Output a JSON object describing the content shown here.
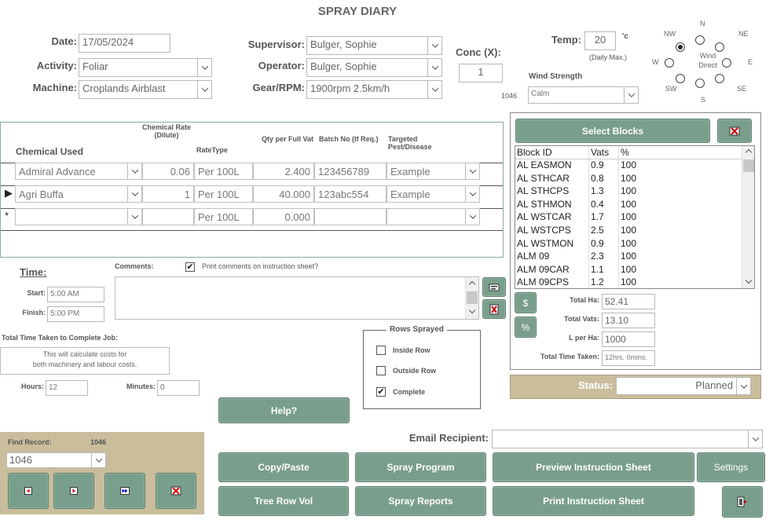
{
  "title": "SPRAY DIARY",
  "form": {
    "date_label": "Date:",
    "date_value": "17/05/2024",
    "activity_label": "Activity:",
    "activity_value": "Foliar",
    "machine_label": "Machine:",
    "machine_value": "Croplands Airblast",
    "supervisor_label": "Supervisor:",
    "supervisor_value": "Bulger, Sophie",
    "operator_label": "Operator:",
    "operator_value": "Bulger, Sophie",
    "gear_label": "Gear/RPM:",
    "gear_value": "1900rpm 2.5km/h",
    "conc_label": "Conc (X):",
    "conc_value": "1",
    "temp_label": "Temp:",
    "temp_value": "20",
    "temp_unit": "'c",
    "temp_note": "(Daily Max.)",
    "record_id_small": "1046",
    "wind_strength_label": "Wind Strength",
    "wind_strength_value": "Calm",
    "wind_direction_label": "Wind Direct",
    "wind_dirs": [
      "N",
      "NE",
      "E",
      "SE",
      "S",
      "SW",
      "W",
      "NW"
    ],
    "wind_selected": "center"
  },
  "chemicals": {
    "headers": {
      "chemical": "Chemical Used",
      "rate": "Chemical Rate (Dilute)",
      "ratetype": "RateType",
      "qty": "Qty per Full Vat",
      "batch": "Batch No (If Req.)",
      "target": "Targeted Pest/Disease"
    },
    "rows": [
      {
        "name": "Admiral Advance",
        "rate": "0.06",
        "ratetype": "Per 100L",
        "qty": "2.400",
        "batch": "123456789",
        "target": "Example",
        "marker": ""
      },
      {
        "name": "Agri Buffa",
        "rate": "1",
        "ratetype": "Per 100L",
        "qty": "40.000",
        "batch": "123abc554",
        "target": "Example",
        "marker": "▶"
      },
      {
        "name": "",
        "rate": "",
        "ratetype": "Per 100L",
        "qty": "0.000",
        "batch": "",
        "target": "",
        "marker": "*"
      }
    ]
  },
  "blocks": {
    "select_label": "Select Blocks",
    "headers": {
      "id": "Block ID",
      "vats": "Vats",
      "pct": "%"
    },
    "rows": [
      {
        "id": "AL EASMON",
        "vats": "0.9",
        "pct": "100"
      },
      {
        "id": "AL STHCAR",
        "vats": "0.8",
        "pct": "100"
      },
      {
        "id": "AL STHCPS",
        "vats": "1.3",
        "pct": "100"
      },
      {
        "id": "AL STHMON",
        "vats": "0.4",
        "pct": "100"
      },
      {
        "id": "AL WSTCAR",
        "vats": "1.7",
        "pct": "100"
      },
      {
        "id": "AL WSTCPS",
        "vats": "2.5",
        "pct": "100"
      },
      {
        "id": "AL WSTMON",
        "vats": "0.9",
        "pct": "100"
      },
      {
        "id": "ALM 09",
        "vats": "2.3",
        "pct": "100"
      },
      {
        "id": "ALM 09CAR",
        "vats": "1.1",
        "pct": "100"
      },
      {
        "id": "ALM 09CPS",
        "vats": "1.2",
        "pct": "100"
      }
    ],
    "dollar_label": "$",
    "pct_label": "%",
    "total_ha_label": "Total Ha:",
    "total_ha": "52.41",
    "total_vats_label": "Total Vats:",
    "total_vats": "13.10",
    "l_per_ha_label": "L per Ha:",
    "l_per_ha": "1000",
    "total_time_label": "Total Time Taken:",
    "total_time": "12hrs. 0mins."
  },
  "status": {
    "label": "Status:",
    "value": "Planned"
  },
  "time": {
    "heading": "Time:",
    "start_label": "Start:",
    "start_value": "5:00 AM",
    "finish_label": "Finish:",
    "finish_value": "5:00 PM",
    "total_label": "Total Time Taken to Complete Job:",
    "note_line1": "This will calculate costs for",
    "note_line2": "both machinery and labour costs.",
    "hours_label": "Hours:",
    "hours_value": "12",
    "minutes_label": "Minutes:",
    "minutes_value": "0"
  },
  "comments": {
    "label": "Comments:",
    "print_label": "Print comments on instruction sheet?",
    "print_checked": true,
    "value": ""
  },
  "rows_sprayed": {
    "title": "Rows Sprayed",
    "items": [
      {
        "label": "Inside Row",
        "checked": false
      },
      {
        "label": "Outside Row",
        "checked": false
      },
      {
        "label": "Complete",
        "checked": true
      }
    ]
  },
  "find": {
    "label": "Find Record:",
    "id_small": "1046",
    "value": "1046"
  },
  "buttons": {
    "help": "Help?",
    "copy_paste": "Copy/Paste",
    "spray_program": "Spray Program",
    "preview": "Preview Instruction Sheet",
    "settings": "Settings",
    "tree_row_vol": "Tree Row Vol",
    "spray_reports": "Spray Reports",
    "print": "Print Instruction Sheet"
  },
  "email": {
    "label": "Email Recipient:",
    "value": ""
  }
}
